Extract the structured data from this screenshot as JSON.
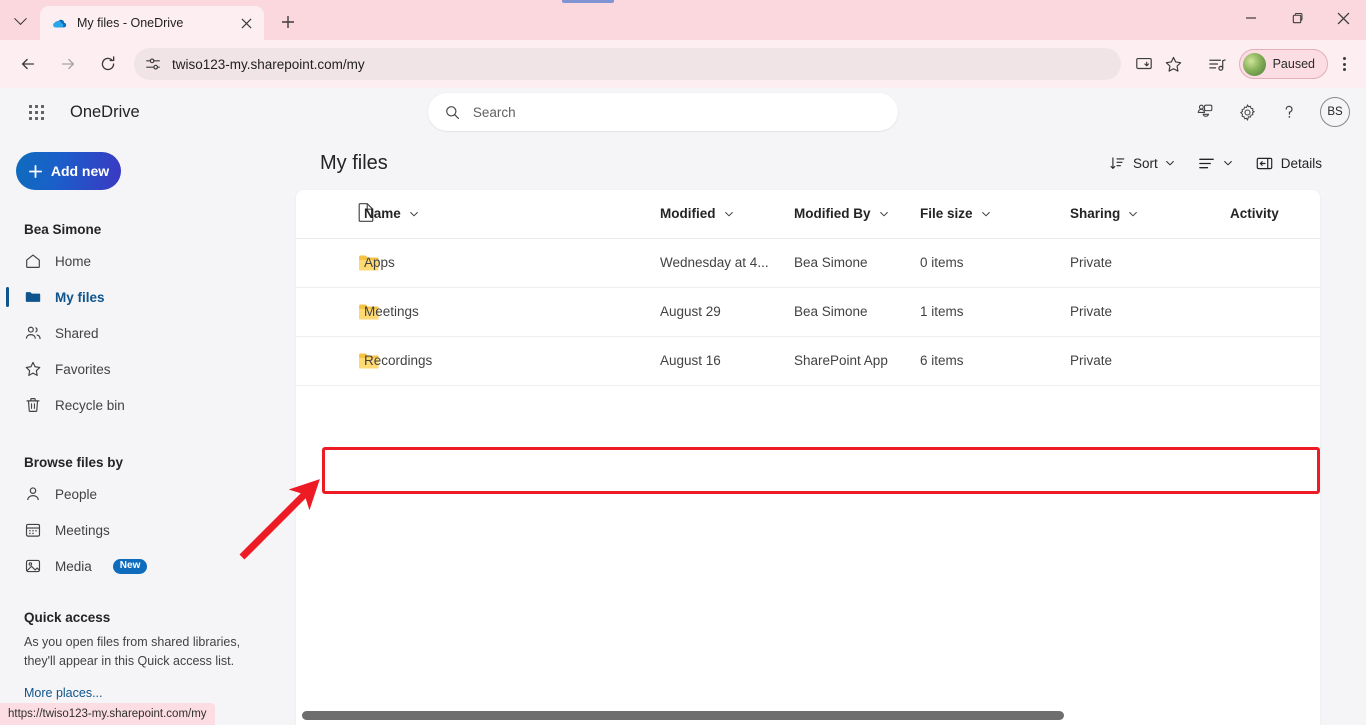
{
  "browser": {
    "tab": {
      "title": "My files - OneDrive",
      "favicon": "onedrive-cloud-icon",
      "close": "close-tab-icon"
    },
    "new_tab_label": "+",
    "url": "twiso123-my.sharepoint.com/my",
    "toolbar_icons": [
      "back-arrow-icon",
      "forward-arrow-icon",
      "reload-icon",
      "site-settings-icon",
      "install-app-icon",
      "bookmark-star-icon",
      "media-controls-icon"
    ],
    "profile": {
      "label": "Paused",
      "avatar": "profile-photo"
    },
    "window_controls": [
      "minimize",
      "maximize",
      "close"
    ],
    "status_url": "https://twiso123-my.sharepoint.com/my"
  },
  "app": {
    "brand": "OneDrive",
    "waffle": "app-launcher-icon",
    "search": {
      "placeholder": "Search",
      "value": ""
    },
    "header_actions": [
      {
        "name": "my-day-icon",
        "label": ""
      },
      {
        "name": "settings-gear-icon",
        "label": ""
      },
      {
        "name": "help-question-icon",
        "label": ""
      }
    ],
    "avatar_initials": "BS"
  },
  "sidebar": {
    "add_new_label": "Add new",
    "account_name": "Bea Simone",
    "items": [
      {
        "label": "Home",
        "icon": "home-icon",
        "active": false
      },
      {
        "label": "My files",
        "icon": "folder-icon",
        "active": true
      },
      {
        "label": "Shared",
        "icon": "people-icon",
        "active": false
      },
      {
        "label": "Favorites",
        "icon": "star-icon",
        "active": false
      },
      {
        "label": "Recycle bin",
        "icon": "trash-icon",
        "active": false
      }
    ],
    "browse_title": "Browse files by",
    "browse_items": [
      {
        "label": "People",
        "icon": "person-icon",
        "badge": ""
      },
      {
        "label": "Meetings",
        "icon": "calendar-icon",
        "badge": ""
      },
      {
        "label": "Media",
        "icon": "image-icon",
        "badge": "New"
      }
    ],
    "quick_access_title": "Quick access",
    "quick_access_text": "As you open files from shared libraries, they'll appear in this Quick access list.",
    "more_places": "More places..."
  },
  "main": {
    "page_title": "My files",
    "toolbar": {
      "sort_label": "Sort",
      "sort_icon": "sort-icon",
      "view_icon": "list-view-icon",
      "details_label": "Details",
      "details_icon": "details-pane-icon"
    },
    "columns": [
      {
        "label": "Name",
        "sortable": true
      },
      {
        "label": "Modified",
        "sortable": true
      },
      {
        "label": "Modified By",
        "sortable": true
      },
      {
        "label": "File size",
        "sortable": true
      },
      {
        "label": "Sharing",
        "sortable": true
      },
      {
        "label": "Activity",
        "sortable": false
      }
    ],
    "rows": [
      {
        "icon": "folder-icon",
        "name": "Apps",
        "modified": "Wednesday at 4...",
        "modified_by": "Bea Simone",
        "size": "0 items",
        "sharing": "Private",
        "activity": "",
        "highlighted": false
      },
      {
        "icon": "folder-icon",
        "name": "Meetings",
        "modified": "August 29",
        "modified_by": "Bea Simone",
        "size": "1 items",
        "sharing": "Private",
        "activity": "",
        "highlighted": false
      },
      {
        "icon": "folder-icon",
        "name": "Recordings",
        "modified": "August 16",
        "modified_by": "SharePoint App",
        "size": "6 items",
        "sharing": "Private",
        "activity": "",
        "highlighted": true
      }
    ]
  },
  "annotations": {
    "highlight_color": "#ed1c24",
    "highlight_target": "Recordings",
    "arrow": "red-pointer-arrow"
  },
  "colors": {
    "brand_blue": "#0f6cbd",
    "accent_dark_blue": "#0f548c",
    "folder_yellow": "#ffd04b",
    "browser_pink": "#fbd7de",
    "annotation_red": "#ed1c24"
  }
}
